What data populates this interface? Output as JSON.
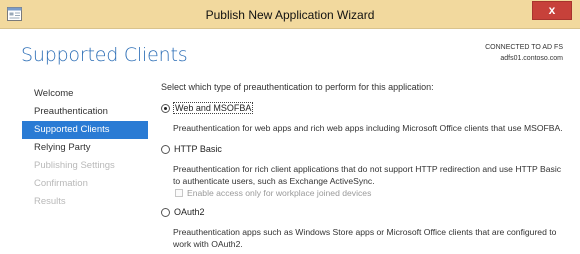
{
  "window": {
    "title": "Publish New Application Wizard",
    "close_label": "x",
    "titlebar_color": "#f2d99e",
    "close_color": "#c7413a"
  },
  "header": {
    "page_title": "Supported Clients",
    "connection_label": "CONNECTED TO AD FS",
    "connection_server": "adfs01.contoso.com",
    "accent": "#2f70b7"
  },
  "sidebar": {
    "items": [
      {
        "label": "Welcome",
        "state": "normal"
      },
      {
        "label": "Preauthentication",
        "state": "normal"
      },
      {
        "label": "Supported Clients",
        "state": "active"
      },
      {
        "label": "Relying Party",
        "state": "normal"
      },
      {
        "label": "Publishing Settings",
        "state": "disabled"
      },
      {
        "label": "Confirmation",
        "state": "disabled"
      },
      {
        "label": "Results",
        "state": "disabled"
      }
    ],
    "active_color": "#2a7bd4"
  },
  "main": {
    "prompt": "Select which type of preauthentication to perform for this application:",
    "options": [
      {
        "label": "Web and MSOFBA",
        "selected": true,
        "description_lines": [
          "Preauthentication for web apps and rich web apps including Microsoft Office clients that use MSOFBA."
        ]
      },
      {
        "label": "HTTP Basic",
        "selected": false,
        "description_lines": [
          "Preauthentication for rich client applications that do not support HTTP redirection and use HTTP Basic",
          "to authenticate users, such as Exchange ActiveSync."
        ],
        "checkbox": {
          "label": "Enable access only for workplace joined devices",
          "checked": false,
          "enabled": false
        }
      },
      {
        "label": "OAuth2",
        "selected": false,
        "description_lines": [
          "Preauthentication apps such as Windows Store apps or Microsoft Office clients that are configured to",
          "work with OAuth2."
        ]
      }
    ]
  }
}
